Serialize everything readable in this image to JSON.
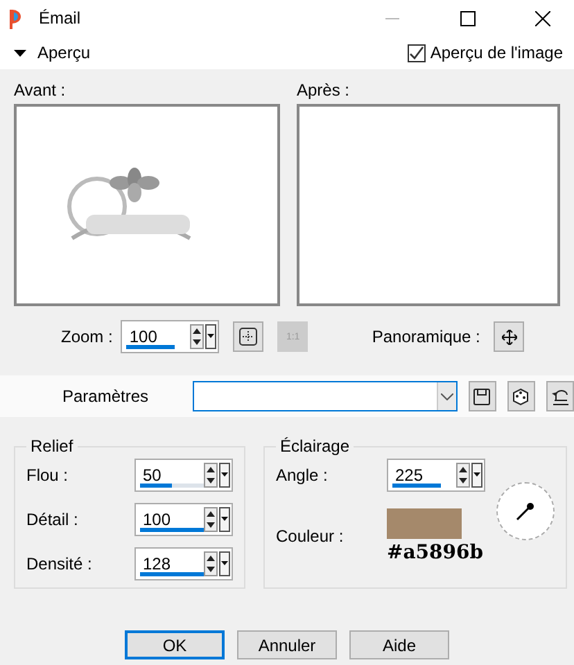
{
  "window": {
    "title": "Émail"
  },
  "preview_toggle": {
    "label": "Aperçu",
    "expanded": true
  },
  "image_preview": {
    "label": "Aperçu de l'image",
    "checked": true
  },
  "before": {
    "label": "Avant :"
  },
  "after": {
    "label": "Après :"
  },
  "zoom": {
    "label": "Zoom :",
    "value": "100",
    "tools": [
      {
        "kind": "fit",
        "disabled": false
      },
      {
        "kind": "actual",
        "label": "1:1",
        "disabled": true
      }
    ]
  },
  "pan": {
    "label": "Panoramique :"
  },
  "presets": {
    "label": "Paramètres"
  },
  "relief": {
    "title": "Relief",
    "fields": [
      {
        "label": "Flou :",
        "value": "50",
        "level": 0.5
      },
      {
        "label": "Détail :",
        "value": "100",
        "level": 1
      },
      {
        "label": "Densité :",
        "value": "128",
        "level": 1
      }
    ]
  },
  "lighting": {
    "title": "Éclairage",
    "angle": {
      "label": "Angle :",
      "value": "225"
    },
    "color_label": "Couleur :",
    "color": "#a5896b",
    "color_code": "#a5896b"
  },
  "buttons": [
    {
      "label": "OK",
      "default": true
    },
    {
      "label": "Annuler",
      "default": false
    },
    {
      "label": "Aide",
      "default": false
    }
  ]
}
